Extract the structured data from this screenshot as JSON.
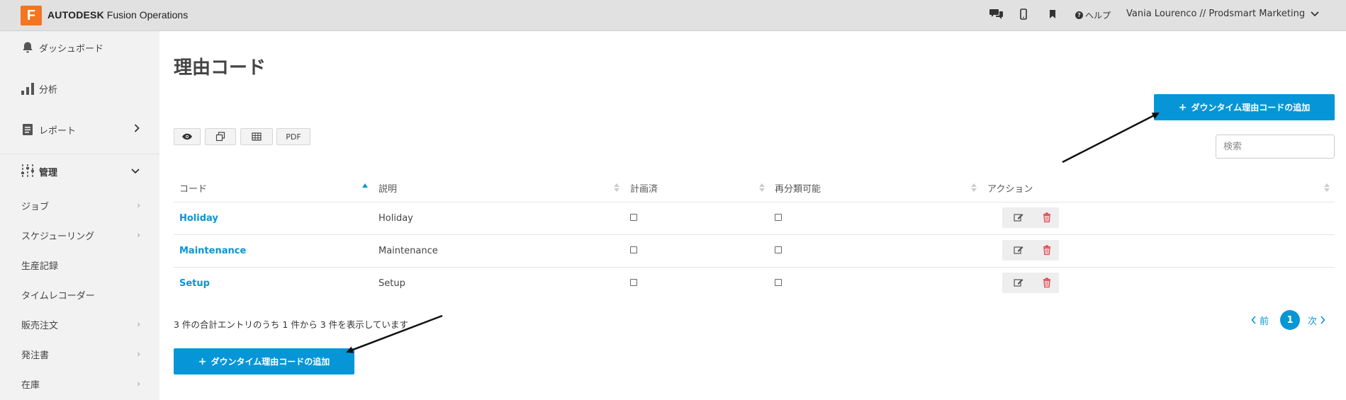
{
  "topbar": {
    "logo_letter": "F",
    "brand_bold": "AUTODESK",
    "brand_rest": "Fusion Operations",
    "icons": [
      "chat-icon",
      "mobile-icon",
      "bookmark-icon"
    ],
    "help_label": "ヘルプ",
    "user_label": "Vania Lourenco // Prodsmart Marketing"
  },
  "sidebar": {
    "dashboard": "ダッシュボード",
    "analysis": "分析",
    "reports": "レポート",
    "admin": "管理",
    "sub_items": [
      {
        "label": "ジョブ",
        "has_chevron": true
      },
      {
        "label": "スケジューリング",
        "has_chevron": true
      },
      {
        "label": "生産記録",
        "has_chevron": false
      },
      {
        "label": "タイムレコーダー",
        "has_chevron": false
      },
      {
        "label": "販売注文",
        "has_chevron": true
      },
      {
        "label": "発注書",
        "has_chevron": true
      },
      {
        "label": "在庫",
        "has_chevron": true
      }
    ]
  },
  "main": {
    "title": "理由コード",
    "add_button_label": "ダウンタイム理由コードの追加",
    "toolbar": {
      "view_icon": "eye-icon",
      "copy_icon": "copy-icon",
      "excel_icon": "table-icon",
      "pdf_label": "PDF"
    },
    "search_placeholder": "検索",
    "table": {
      "columns": [
        "コード",
        "説明",
        "計画済",
        "再分類可能",
        "アクション"
      ],
      "rows": [
        {
          "code": "Holiday",
          "description": "Holiday",
          "planned": false,
          "reclassifiable": false
        },
        {
          "code": "Maintenance",
          "description": "Maintenance",
          "planned": false,
          "reclassifiable": false
        },
        {
          "code": "Setup",
          "description": "Setup",
          "planned": false,
          "reclassifiable": false
        }
      ]
    },
    "info_text": "3 件の合計エントリのうち 1 件から 3 件を表示しています",
    "pagination": {
      "prev": "前",
      "current": "1",
      "next": "次"
    }
  },
  "colors": {
    "accent": "#0696d7",
    "logo": "#f37521",
    "delete": "#e0464e"
  }
}
